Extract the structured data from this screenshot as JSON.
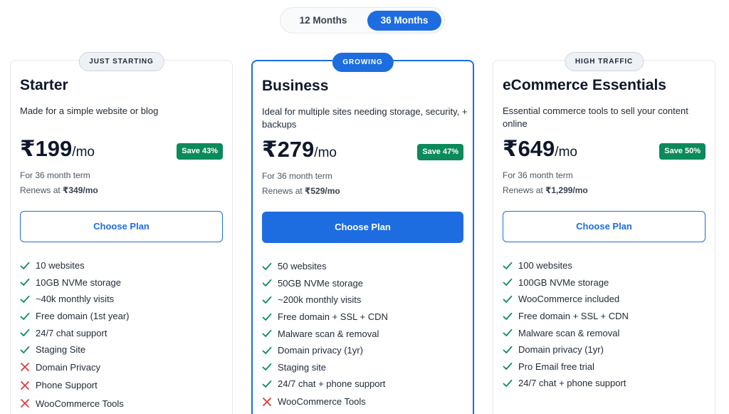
{
  "billing_toggle": {
    "options": [
      "12 Months",
      "36 Months"
    ],
    "selected": "36 Months"
  },
  "colors": {
    "accent": "#1e6de0",
    "save_badge": "#0b8a5c",
    "check": "#0b8a5c",
    "cross": "#e03b3b"
  },
  "plans": [
    {
      "tag": "JUST STARTING",
      "name": "Starter",
      "description": "Made for a simple website or blog",
      "price": "₹199",
      "per": "/mo",
      "save": "Save 43%",
      "term": "For 36 month term",
      "renew_prefix": "Renews at ",
      "renew_price": "₹349/mo",
      "cta": "Choose Plan",
      "features": [
        {
          "text": "10 websites",
          "included": true
        },
        {
          "text": "10GB NVMe storage",
          "included": true
        },
        {
          "text": "~40k monthly visits",
          "included": true
        },
        {
          "text": "Free domain (1st year)",
          "included": true
        },
        {
          "text": "24/7 chat support",
          "included": true
        },
        {
          "text": "Staging Site",
          "included": true
        },
        {
          "text": "Domain Privacy",
          "included": false
        },
        {
          "text": "Phone Support",
          "included": false
        },
        {
          "text": "WooCommerce Tools",
          "included": false
        }
      ]
    },
    {
      "tag": "GROWING",
      "name": "Business",
      "description": "Ideal for multiple sites needing storage, security, + backups",
      "price": "₹279",
      "per": "/mo",
      "save": "Save 47%",
      "term": "For 36 month term",
      "renew_prefix": "Renews at ",
      "renew_price": "₹529/mo",
      "cta": "Choose Plan",
      "features": [
        {
          "text": "50 websites",
          "included": true
        },
        {
          "text": "50GB NVMe storage",
          "included": true
        },
        {
          "text": "~200k monthly visits",
          "included": true
        },
        {
          "text": "Free domain + SSL + CDN",
          "included": true
        },
        {
          "text": "Malware scan & removal",
          "included": true
        },
        {
          "text": "Domain privacy (1yr)",
          "included": true
        },
        {
          "text": "Staging site",
          "included": true
        },
        {
          "text": "24/7 chat + phone support",
          "included": true
        },
        {
          "text": "WooCommerce Tools",
          "included": false
        }
      ]
    },
    {
      "tag": "HIGH TRAFFIC",
      "name": "eCommerce Essentials",
      "description": "Essential commerce tools to sell your content online",
      "price": "₹649",
      "per": "/mo",
      "save": "Save 50%",
      "term": "For 36 month term",
      "renew_prefix": "Renews at ",
      "renew_price": "₹1,299/mo",
      "cta": "Choose Plan",
      "features": [
        {
          "text": "100 websites",
          "included": true
        },
        {
          "text": "100GB NVMe storage",
          "included": true
        },
        {
          "text": "WooCommerce included",
          "included": true
        },
        {
          "text": "Free domain + SSL + CDN",
          "included": true
        },
        {
          "text": "Malware scan & removal",
          "included": true
        },
        {
          "text": "Domain privacy (1yr)",
          "included": true
        },
        {
          "text": "Pro Email free trial",
          "included": true
        },
        {
          "text": "24/7 chat + phone support",
          "included": true
        }
      ]
    }
  ]
}
